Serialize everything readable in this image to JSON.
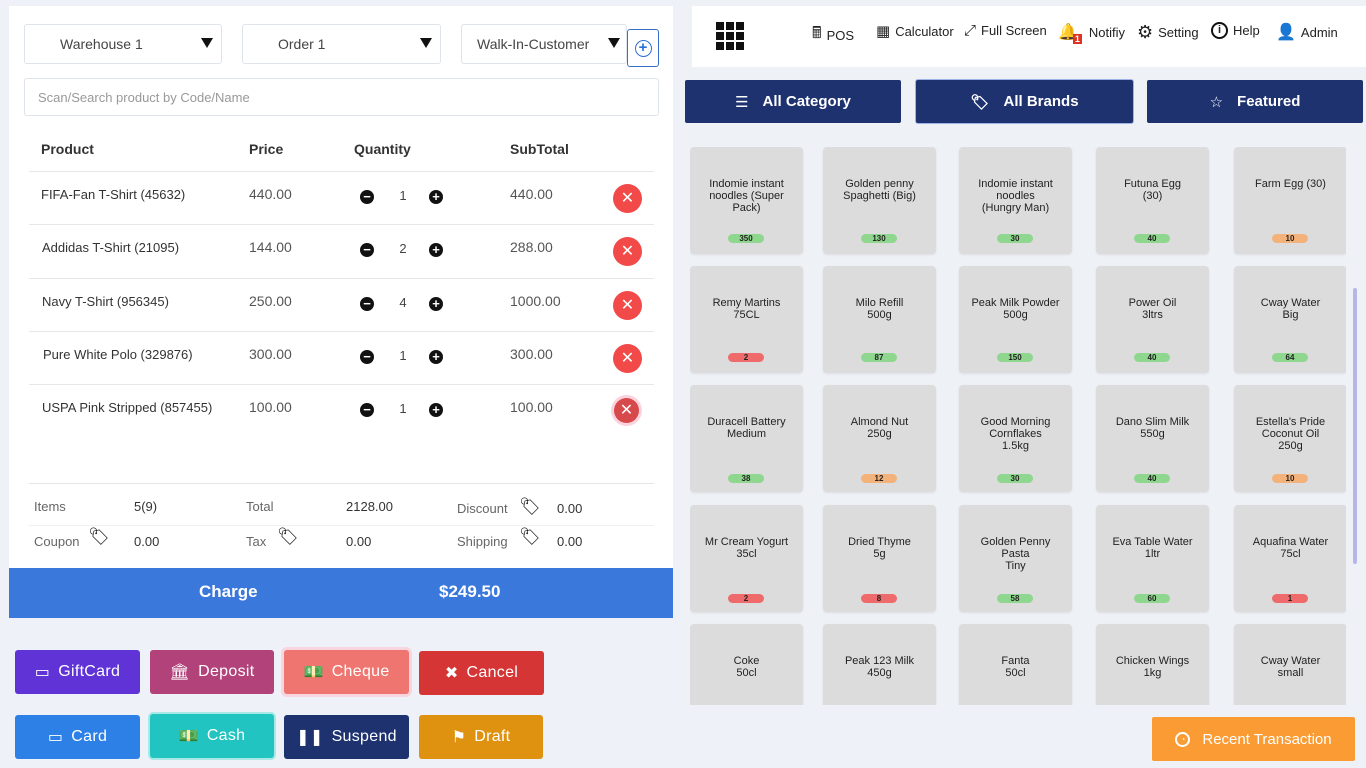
{
  "filters": {
    "warehouse": "Warehouse 1",
    "order": "Order 1",
    "customer": "Walk-In-Customer"
  },
  "search": {
    "placeholder": "Scan/Search product by Code/Name"
  },
  "table": {
    "headers": {
      "product": "Product",
      "price": "Price",
      "quantity": "Quantity",
      "subtotal": "SubTotal"
    },
    "rows": [
      {
        "product": "FIFA-Fan T-Shirt (45632)",
        "price": "440.00",
        "qty": "1",
        "subtotal": "440.00"
      },
      {
        "product": "Addidas T-Shirt (21095)",
        "price": "144.00",
        "qty": "2",
        "subtotal": "288.00"
      },
      {
        "product": "Navy T-Shirt (956345)",
        "price": "250.00",
        "qty": "4",
        "subtotal": "1000.00"
      },
      {
        "product": "Pure White Polo (329876)",
        "price": "300.00",
        "qty": "1",
        "subtotal": "300.00"
      },
      {
        "product": "USPA Pink Stripped (857455)",
        "price": "100.00",
        "qty": "1",
        "subtotal": "100.00"
      }
    ]
  },
  "summary": {
    "items_label": "Items",
    "items_value": "5(9)",
    "total_label": "Total",
    "total_value": "2128.00",
    "discount_label": "Discount",
    "discount_value": "0.00",
    "coupon_label": "Coupon",
    "coupon_value": "0.00",
    "tax_label": "Tax",
    "tax_value": "0.00",
    "shipping_label": "Shipping",
    "shipping_value": "0.00"
  },
  "charge": {
    "label": "Charge",
    "amount": "$249.50"
  },
  "actions": {
    "giftcard": "GiftCard",
    "deposit": "Deposit",
    "cheque": "Cheque",
    "cancel": "Cancel",
    "card": "Card",
    "cash": "Cash",
    "suspend": "Suspend",
    "draft": "Draft"
  },
  "nav": {
    "pos": "POS",
    "calculator": "Calculator",
    "fullscreen": "Full Screen",
    "notify": "Notifiy",
    "notify_count": "1",
    "setting": "Setting",
    "help": "Help",
    "admin": "Admin"
  },
  "categories": {
    "all_category": "All Category",
    "all_brands": "All Brands",
    "featured": "Featured"
  },
  "products": [
    {
      "name": "Indomie instant\nnoodles (Super\nPack)",
      "qty": "350",
      "color": "#8fd68f"
    },
    {
      "name": "Golden penny\nSpaghetti (Big)",
      "qty": "130",
      "color": "#8fd68f"
    },
    {
      "name": "Indomie instant\nnoodles\n(Hungry Man)",
      "qty": "30",
      "color": "#8fd68f"
    },
    {
      "name": "Futuna Egg\n(30)",
      "qty": "40",
      "color": "#8fd68f"
    },
    {
      "name": "Farm Egg (30)",
      "qty": "10",
      "color": "#f3b27a"
    },
    {
      "name": "Remy Martins\n75CL",
      "qty": "2",
      "color": "#ef6b6b"
    },
    {
      "name": "Milo Refill\n500g",
      "qty": "87",
      "color": "#8fd68f"
    },
    {
      "name": "Peak Milk Powder\n500g",
      "qty": "150",
      "color": "#8fd68f"
    },
    {
      "name": "Power Oil\n3ltrs",
      "qty": "40",
      "color": "#8fd68f"
    },
    {
      "name": "Cway Water\nBig",
      "qty": "64",
      "color": "#8fd68f"
    },
    {
      "name": "Duracell Battery\nMedium",
      "qty": "38",
      "color": "#8fd68f"
    },
    {
      "name": "Almond Nut\n250g",
      "qty": "12",
      "color": "#f3b27a"
    },
    {
      "name": "Good Morning\nCornflakes\n1.5kg",
      "qty": "30",
      "color": "#8fd68f"
    },
    {
      "name": "Dano Slim Milk\n550g",
      "qty": "40",
      "color": "#8fd68f"
    },
    {
      "name": "Estella's Pride\nCoconut Oil\n250g",
      "qty": "10",
      "color": "#f3b27a"
    },
    {
      "name": "Mr Cream Yogurt\n35cl",
      "qty": "2",
      "color": "#ef6b6b"
    },
    {
      "name": "Dried Thyme\n5g",
      "qty": "8",
      "color": "#ef6b6b"
    },
    {
      "name": "Golden Penny\nPasta\nTiny",
      "qty": "58",
      "color": "#8fd68f"
    },
    {
      "name": "Eva Table Water\n1ltr",
      "qty": "60",
      "color": "#8fd68f"
    },
    {
      "name": "Aquafina Water\n75cl",
      "qty": "1",
      "color": "#ef6b6b"
    },
    {
      "name": "Coke\n50cl",
      "qty": "",
      "color": "#dcdcdc"
    },
    {
      "name": "Peak 123 Milk\n450g",
      "qty": "",
      "color": "#dcdcdc"
    },
    {
      "name": "Fanta\n50cl",
      "qty": "",
      "color": "#dcdcdc"
    },
    {
      "name": "Chicken Wings\n1kg",
      "qty": "",
      "color": "#dcdcdc"
    },
    {
      "name": "Cway Water\nsmall",
      "qty": "",
      "color": "#dcdcdc"
    }
  ],
  "recent": {
    "label": "Recent Transaction"
  }
}
